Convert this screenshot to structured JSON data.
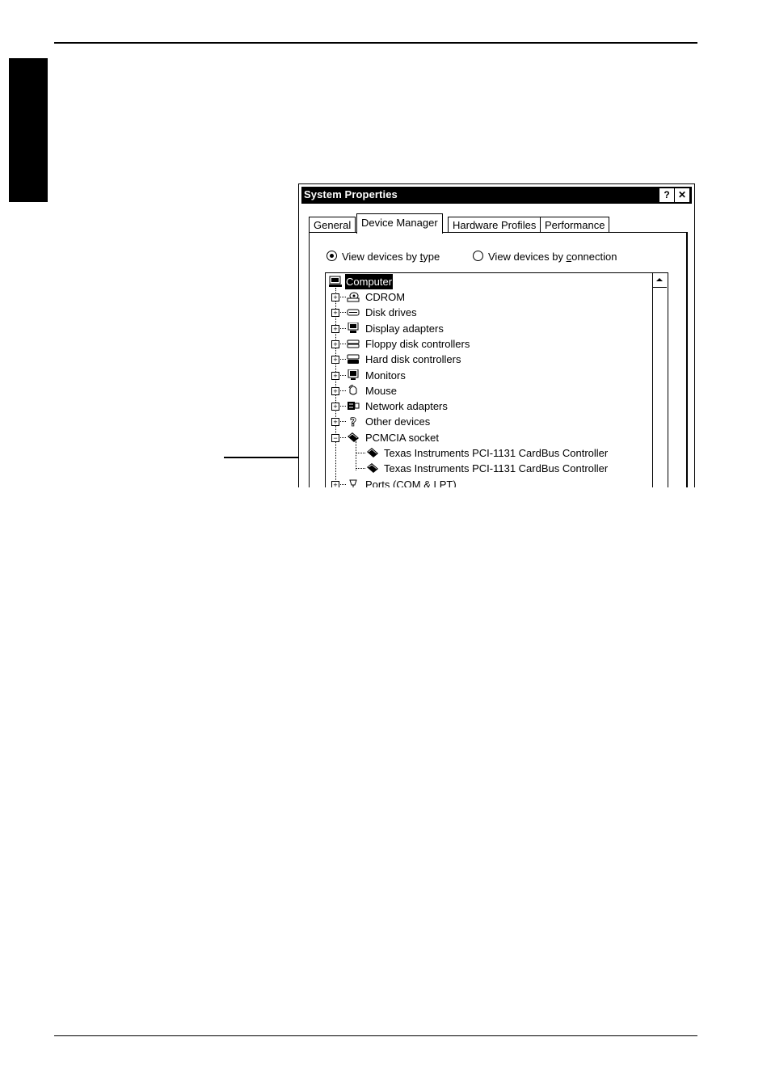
{
  "window": {
    "title": "System Properties",
    "help_button": "?",
    "close_button": "✕"
  },
  "tabs": [
    {
      "label": "General"
    },
    {
      "label": "Device Manager"
    },
    {
      "label": "Hardware Profiles"
    },
    {
      "label": "Performance"
    }
  ],
  "view_options": {
    "by_type_prefix": "View devices by ",
    "by_type_accel": "t",
    "by_type_suffix": "ype",
    "by_connection_prefix": "View devices by ",
    "by_connection_accel": "c",
    "by_connection_suffix": "onnection",
    "selected": "by_type"
  },
  "tree": {
    "root": "Computer",
    "items": [
      {
        "label": "CDROM",
        "icon": "cdrom-icon"
      },
      {
        "label": "Disk drives",
        "icon": "disk-drive-icon"
      },
      {
        "label": "Display adapters",
        "icon": "display-adapter-icon"
      },
      {
        "label": "Floppy disk controllers",
        "icon": "floppy-controller-icon"
      },
      {
        "label": "Hard disk controllers",
        "icon": "hard-disk-controller-icon"
      },
      {
        "label": "Monitors",
        "icon": "monitor-icon"
      },
      {
        "label": "Mouse",
        "icon": "mouse-icon"
      },
      {
        "label": "Network adapters",
        "icon": "network-adapter-icon"
      },
      {
        "label": "Other devices",
        "icon": "question-mark-icon"
      },
      {
        "label": "PCMCIA socket",
        "icon": "pcmcia-icon"
      },
      {
        "label": "Texas Instruments PCI-1131 CardBus Controller",
        "icon": "pcmcia-icon"
      },
      {
        "label": "Texas Instruments PCI-1131 CardBus Controller",
        "icon": "pcmcia-icon"
      },
      {
        "label": "Ports (COM & LPT)",
        "icon": "port-icon"
      }
    ]
  }
}
